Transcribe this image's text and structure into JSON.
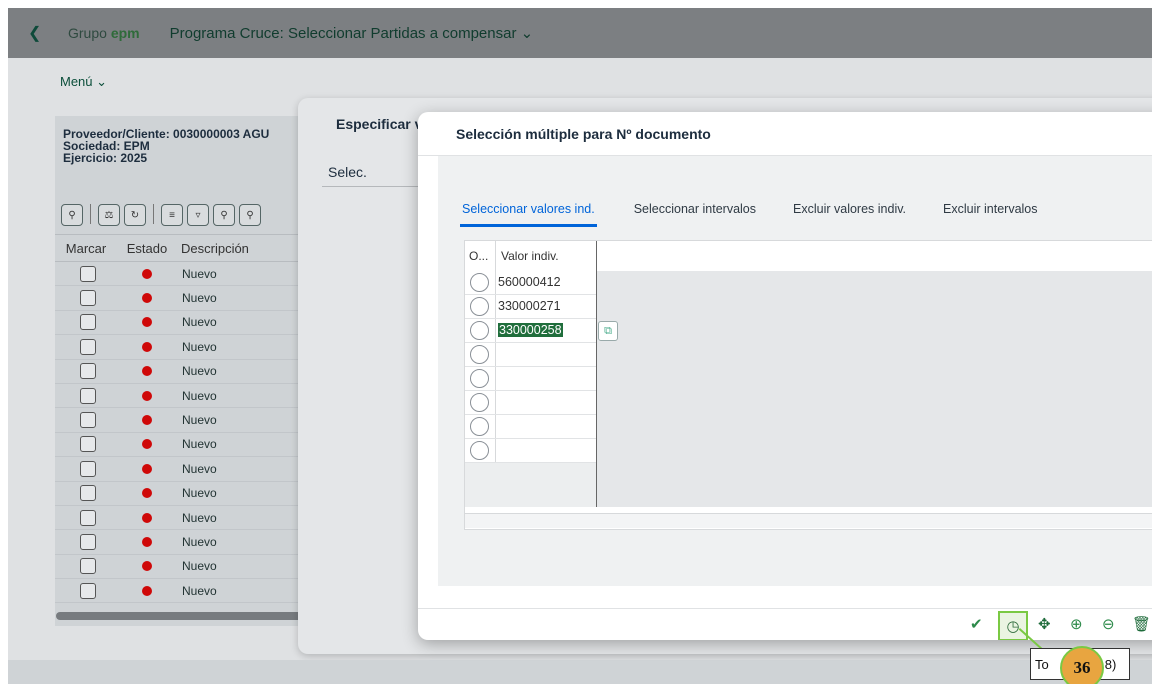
{
  "shell": {
    "back_icon": "chevron-left-icon",
    "logo_prefix": "Grupo ",
    "logo_brand": "epm",
    "app_title": "Programa Cruce: Seleccionar Partidas a compensar",
    "title_dropdown_icon": "chevron-down-icon",
    "brand_color": "#2f6b3a"
  },
  "menu": {
    "label": "Menú"
  },
  "background_panel": {
    "info": [
      "Proveedor/Cliente: 0030000003 AGU",
      "Sociedad: EPM",
      "Ejercicio: 2025"
    ],
    "columns": [
      "Marcar",
      "Estado",
      "Descripción"
    ],
    "rows": [
      "Nuevo",
      "Nuevo",
      "Nuevo",
      "Nuevo",
      "Nuevo",
      "Nuevo",
      "Nuevo",
      "Nuevo",
      "Nuevo",
      "Nuevo",
      "Nuevo",
      "Nuevo",
      "Nuevo",
      "Nuevo"
    ],
    "status_color": "#cf0808"
  },
  "middle_dialog": {
    "title": "Especificar v",
    "selec_label": "Selec."
  },
  "dialog": {
    "title": "Selección múltiple para Nº documento",
    "tabs": [
      "Seleccionar valores ind.",
      "Seleccionar intervalos",
      "Excluir valores indiv.",
      "Excluir intervalos"
    ],
    "active_tab": 0,
    "grid": {
      "col_o": "O...",
      "col_value": "Valor indiv.",
      "values": [
        "560000412",
        "330000271",
        "330000258",
        "",
        "",
        "",
        "",
        ""
      ],
      "selected_index": 2
    },
    "footer_icons": [
      "checkmark-icon",
      "clock-refresh-icon",
      "move-icon",
      "add-icon",
      "remove-icon",
      "delete-icon"
    ]
  },
  "tooltip": {
    "prefix": "To",
    "suffix": "8)"
  },
  "annotation": {
    "step": "36",
    "color": "#7ac943"
  }
}
